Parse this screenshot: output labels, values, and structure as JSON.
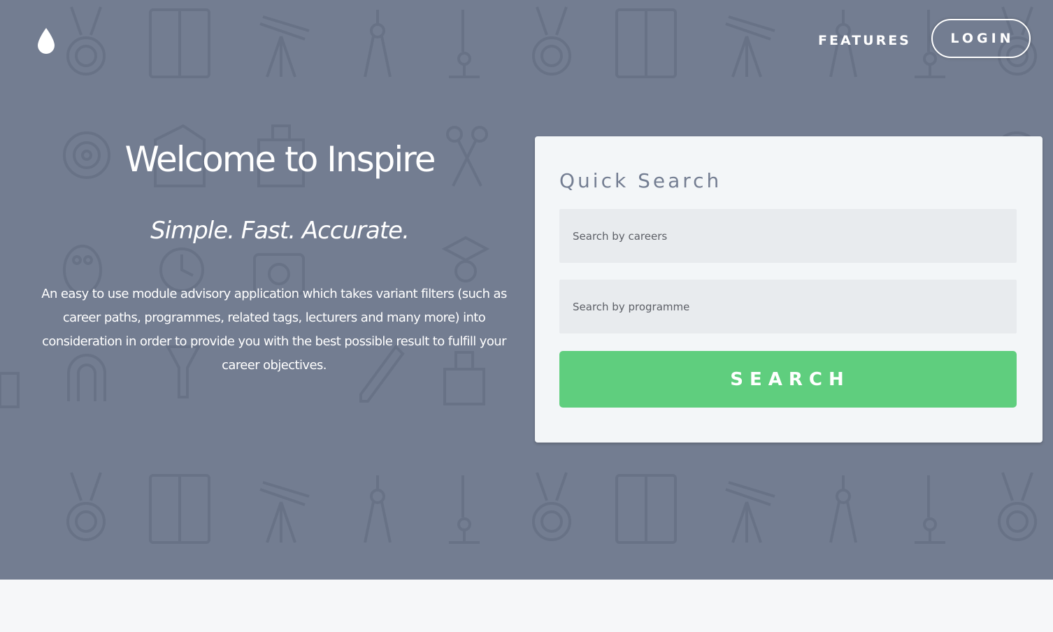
{
  "nav": {
    "logo_icon": "water-drop-icon",
    "features_label": "FEATURES",
    "login_label": "LOGIN"
  },
  "hero": {
    "title": "Welcome to Inspire",
    "tagline": "Simple. Fast. Accurate.",
    "description": "An easy to use module advisory application which takes variant filters (such as career paths, programmes, related tags, lecturers and many more) into consideration in order to provide you with the best possible result to fulfill your career objectives.",
    "background_color": "#737d91",
    "background_pattern_icons": [
      "medal-icon",
      "book-icon",
      "telescope-icon",
      "compass-icon",
      "microscope-icon",
      "target-icon",
      "scissors-icon",
      "palette-icon",
      "magnet-icon",
      "funnel-icon",
      "pencil-icon",
      "building-icon",
      "graduate-icon",
      "camera-icon"
    ]
  },
  "quick_search": {
    "title": "Quick Search",
    "careers_placeholder": "Search by careers",
    "programme_placeholder": "Search by programme",
    "button_label": "SEARCH",
    "button_color": "#5fce7e"
  },
  "colors": {
    "page_background": "#f6f7f9",
    "card_background": "#f3f6f8",
    "card_title": "#747e92",
    "input_background": "#e8ebee"
  }
}
